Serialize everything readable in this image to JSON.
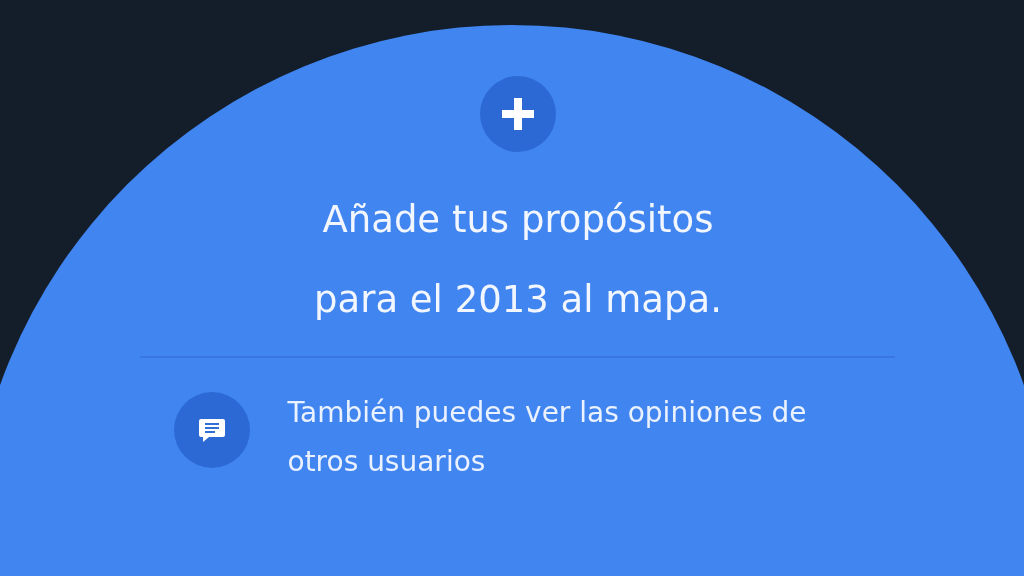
{
  "heading": "Añade tus propósitos para el 2013 al mapa.",
  "info_text": "También puedes ver las opiniones de otros usuarios"
}
